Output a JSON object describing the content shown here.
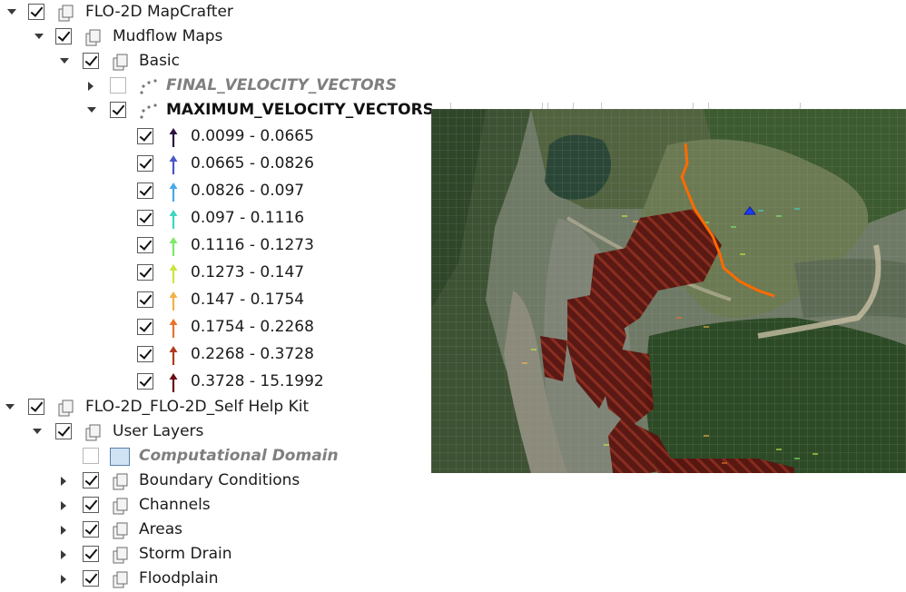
{
  "layers_panel": {
    "groups": [
      {
        "label": "FLO-2D MapCrafter"
      },
      {
        "label": "Mudflow Maps"
      },
      {
        "label": "Basic"
      }
    ],
    "final_layer": {
      "label": "FINAL_VELOCITY_VECTORS"
    },
    "max_layer": {
      "label": "MAXIMUM_VELOCITY_VECTORS"
    },
    "legend": [
      {
        "range": "0.0099 - 0.0665",
        "color": "#2a1340"
      },
      {
        "range": "0.0665 - 0.0826",
        "color": "#4a55c8"
      },
      {
        "range": "0.0826 - 0.097",
        "color": "#4aa8e8"
      },
      {
        "range": "0.097 - 0.1116",
        "color": "#3ed6c0"
      },
      {
        "range": "0.1116 - 0.1273",
        "color": "#7ee86a"
      },
      {
        "range": "0.1273 - 0.147",
        "color": "#c8e83c"
      },
      {
        "range": "0.147 - 0.1754",
        "color": "#f2b24a"
      },
      {
        "range": "0.1754 - 0.2268",
        "color": "#e8742c"
      },
      {
        "range": "0.2268 - 0.3728",
        "color": "#b03a1e"
      },
      {
        "range": "0.3728 - 15.1992",
        "color": "#6a0f14"
      }
    ],
    "selfhelp": {
      "label": "FLO-2D_FLO-2D_Self Help Kit",
      "user_layers": "User Layers",
      "computational_domain": "Computational Domain",
      "items": [
        {
          "label": "Boundary Conditions"
        },
        {
          "label": "Channels"
        },
        {
          "label": "Areas"
        },
        {
          "label": "Storm Drain"
        },
        {
          "label": "Floodplain"
        }
      ]
    }
  }
}
